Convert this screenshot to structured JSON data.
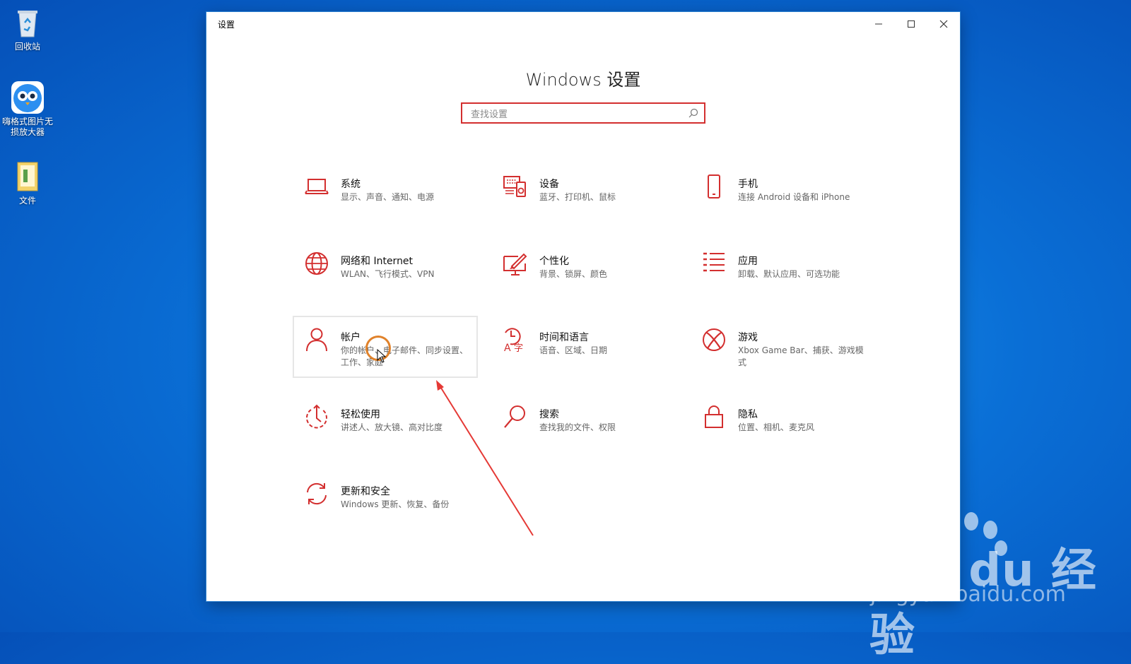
{
  "desktop": {
    "icons": [
      {
        "label": "回收站",
        "icon": "recycle-bin-icon"
      },
      {
        "label": "嗨格式图片无损放大器",
        "icon": "owl-app-icon"
      },
      {
        "label": "文件",
        "icon": "folder-icon"
      }
    ]
  },
  "window": {
    "title": "设置",
    "heading": "Windows 设置",
    "search": {
      "placeholder": "查找设置",
      "icon": "search-icon"
    },
    "controls": [
      "minimize",
      "maximize",
      "close"
    ],
    "accent": "#d32f2f",
    "tiles": [
      {
        "name": "系统",
        "desc": "显示、声音、通知、电源",
        "icon": "laptop-icon"
      },
      {
        "name": "设备",
        "desc": "蓝牙、打印机、鼠标",
        "icon": "devices-icon"
      },
      {
        "name": "手机",
        "desc": "连接 Android 设备和 iPhone",
        "icon": "phone-icon"
      },
      {
        "name": "网络和 Internet",
        "desc": "WLAN、飞行模式、VPN",
        "icon": "globe-icon"
      },
      {
        "name": "个性化",
        "desc": "背景、锁屏、颜色",
        "icon": "personalize-icon"
      },
      {
        "name": "应用",
        "desc": "卸载、默认应用、可选功能",
        "icon": "apps-list-icon"
      },
      {
        "name": "帐户",
        "desc": "你的帐户、电子邮件、同步设置、工作、家庭",
        "icon": "person-icon"
      },
      {
        "name": "时间和语言",
        "desc": "语音、区域、日期",
        "icon": "time-language-icon"
      },
      {
        "name": "游戏",
        "desc": "Xbox Game Bar、捕获、游戏模式",
        "icon": "xbox-icon"
      },
      {
        "name": "轻松使用",
        "desc": "讲述人、放大镜、高对比度",
        "icon": "ease-of-access-icon"
      },
      {
        "name": "搜索",
        "desc": "查找我的文件、权限",
        "icon": "search-icon"
      },
      {
        "name": "隐私",
        "desc": "位置、相机、麦克风",
        "icon": "lock-icon"
      },
      {
        "name": "更新和安全",
        "desc": "Windows 更新、恢复、备份",
        "icon": "sync-icon"
      }
    ]
  },
  "watermark": {
    "brand": "Bai du 经验",
    "url": "jingyan.baidu.com"
  }
}
